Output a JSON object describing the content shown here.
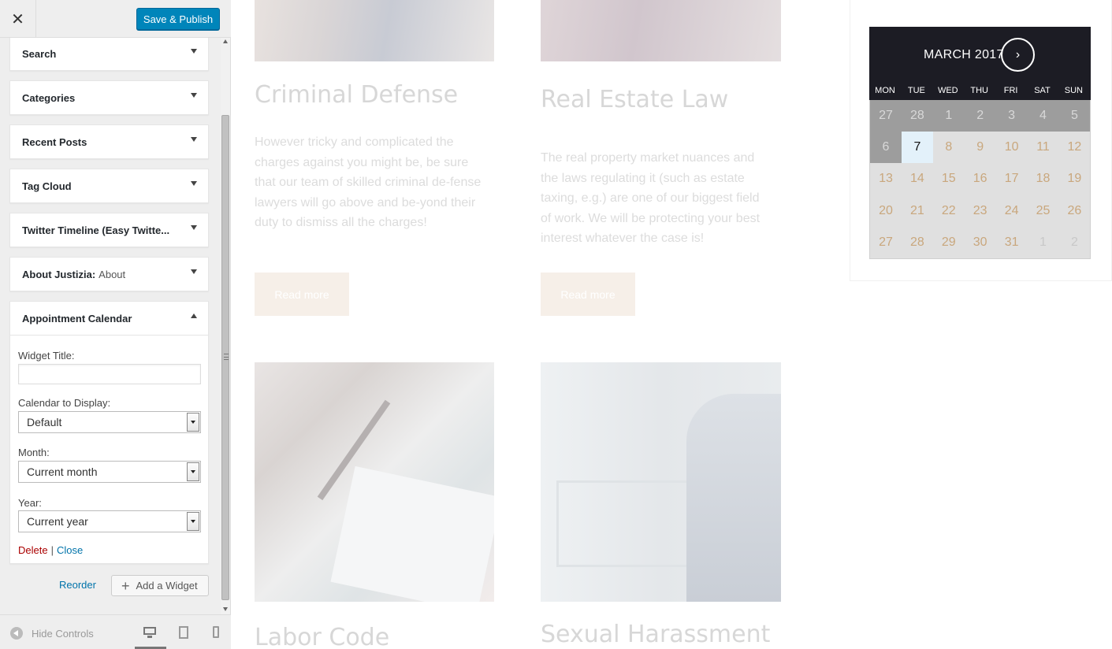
{
  "sidebar": {
    "close_symbol": "✕",
    "save_label": "Save & Publish",
    "widgets": [
      {
        "title": "Search"
      },
      {
        "title": "Categories"
      },
      {
        "title": "Recent Posts"
      },
      {
        "title": "Tag Cloud"
      },
      {
        "title": "Twitter Timeline (Easy Twitte..."
      },
      {
        "title": "About Justizia:",
        "subtitle": "About"
      },
      {
        "title": "Appointment Calendar"
      }
    ],
    "form": {
      "widget_title_label": "Widget Title:",
      "widget_title_value": "",
      "calendar_label": "Calendar to Display:",
      "calendar_value": "Default",
      "month_label": "Month:",
      "month_value": "Current month",
      "year_label": "Year:",
      "year_value": "Current year",
      "delete_label": "Delete",
      "separator": "|",
      "close_label": "Close"
    },
    "reorder_label": "Reorder",
    "add_widget_label": "Add a Widget",
    "add_widget_symbol": "+",
    "hide_controls_label": "Hide Controls"
  },
  "preview": {
    "posts": [
      {
        "title": "Criminal Defense",
        "text": "However tricky and complicated the charges against you might be, be sure that our team of skilled criminal de-fense lawyers will go above and be-yond their duty to dismiss all the charges!",
        "button": "Read more"
      },
      {
        "title": "Real Estate Law",
        "text": "The real property market nuances and the laws regulating it (such as estate taxing, e.g.) are one of our biggest field of work. We will be protecting your best interest whatever the case is!",
        "button": "Read more"
      },
      {
        "title": "Labor Code"
      },
      {
        "title": "Sexual Harassment"
      }
    ]
  },
  "calendar": {
    "month_label": "MARCH 2017",
    "next_symbol": "›",
    "weekdays": [
      "MON",
      "TUE",
      "WED",
      "THU",
      "FRI",
      "SAT",
      "SUN"
    ],
    "weeks": [
      [
        "27",
        "28",
        "1",
        "2",
        "3",
        "4",
        "5"
      ],
      [
        "6",
        "7",
        "8",
        "9",
        "10",
        "11",
        "12"
      ],
      [
        "13",
        "14",
        "15",
        "16",
        "17",
        "18",
        "19"
      ],
      [
        "20",
        "21",
        "22",
        "23",
        "24",
        "25",
        "26"
      ],
      [
        "27",
        "28",
        "29",
        "30",
        "31",
        "1",
        "2"
      ]
    ],
    "states": [
      [
        "past",
        "past",
        "past",
        "past",
        "past",
        "past",
        "past"
      ],
      [
        "past",
        "today",
        "avail",
        "avail",
        "avail",
        "avail",
        "avail"
      ],
      [
        "avail",
        "avail",
        "avail",
        "avail",
        "avail",
        "avail",
        "avail"
      ],
      [
        "avail",
        "avail",
        "avail",
        "avail",
        "avail",
        "avail",
        "avail"
      ],
      [
        "avail",
        "avail",
        "avail",
        "avail",
        "avail",
        "other",
        "other"
      ]
    ],
    "colors": {
      "header": "#1c1c24",
      "past": "#9d9d9d",
      "today": "#e3f1fa",
      "available_text": "#c9a77d"
    }
  }
}
